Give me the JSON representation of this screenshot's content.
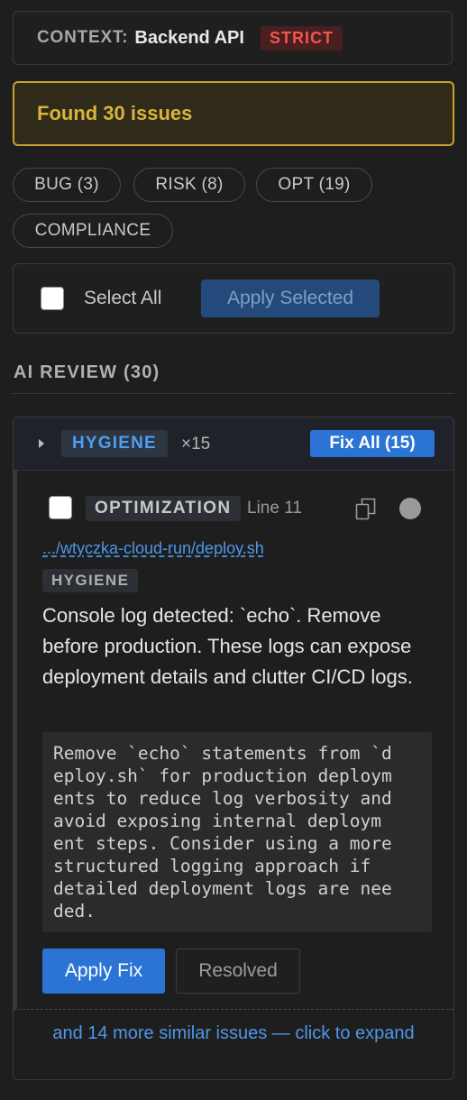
{
  "context": {
    "label": "CONTEXT:",
    "value": "Backend API",
    "mode_badge": "STRICT"
  },
  "summary": {
    "found_text": "Found 30 issues"
  },
  "filters": [
    {
      "label": "BUG (3)"
    },
    {
      "label": "RISK (8)"
    },
    {
      "label": "OPT (19)"
    },
    {
      "label": "COMPLIANCE"
    }
  ],
  "bulk_actions": {
    "select_all_label": "Select All",
    "select_all_checked": false,
    "apply_selected_label": "Apply Selected"
  },
  "section": {
    "title": "AI REVIEW (30)"
  },
  "group": {
    "category": "HYGIENE",
    "count_text": "×15",
    "fix_all_label": "Fix All (15)",
    "expanded": true,
    "issue": {
      "checked": false,
      "type": "OPTIMIZATION",
      "line": "Line 11",
      "copy_icon": "copy-icon",
      "status_icon": "status-dot-icon",
      "file_path": ".../wtyczka-cloud-run/deploy.sh",
      "tag": "HYGIENE",
      "message": "Console log detected: `echo`. Remove before production. These logs can expose deployment details and clutter CI/CD logs.",
      "suggestion": "Remove `echo` statements from `deploy.sh` for production deployments to reduce log verbosity and avoid exposing internal deployment steps. Consider using a more structured logging approach if detailed deployment logs are needed.",
      "apply_fix_label": "Apply Fix",
      "resolved_label": "Resolved"
    },
    "more_text": "and 14 more similar issues — click to expand"
  },
  "colors": {
    "background": "#1e1e1e",
    "accent_blue": "#2b74d6",
    "link_blue": "#4e97e8",
    "warning_yellow": "#d9b43a",
    "strict_red": "#f0564e"
  }
}
